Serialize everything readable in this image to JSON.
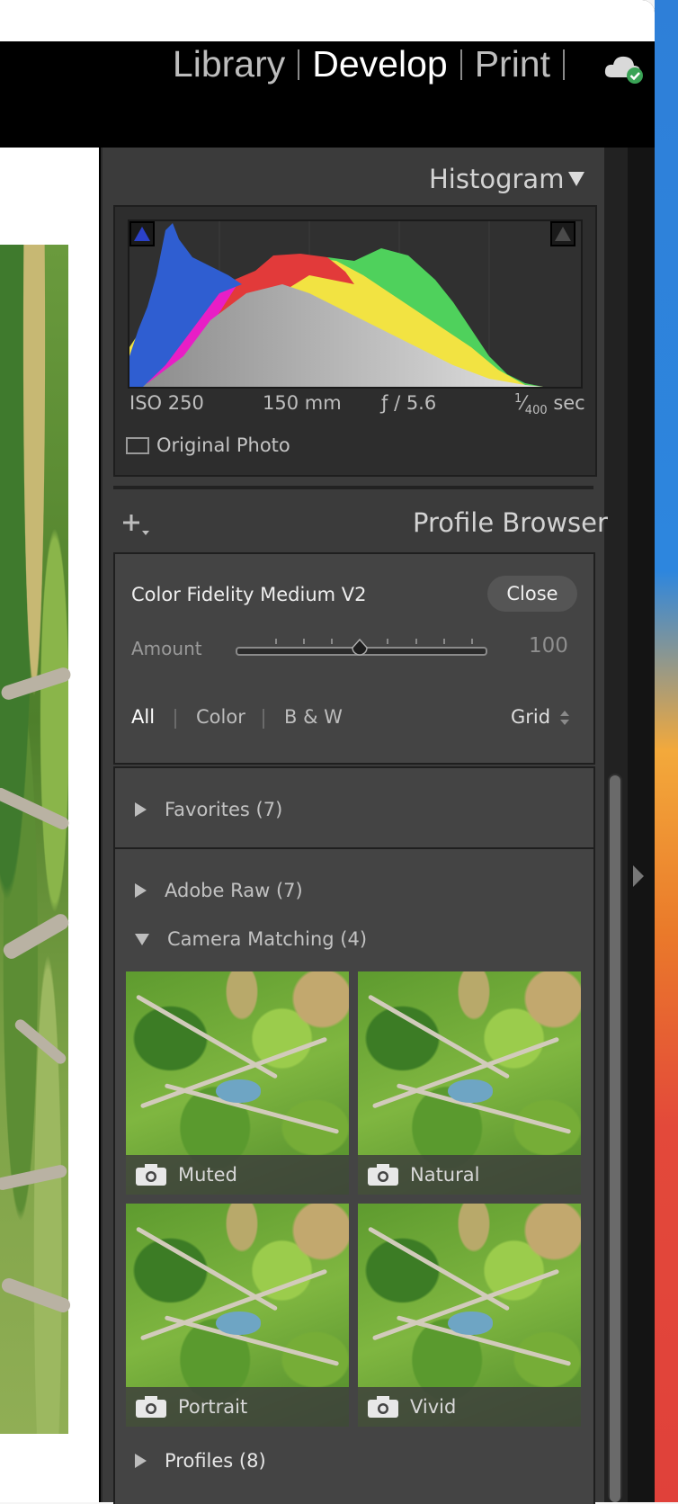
{
  "modules": [
    "Library",
    "Develop",
    "Print"
  ],
  "active_module": "Develop",
  "histogram": {
    "title": "Histogram",
    "iso": "ISO 250",
    "focal": "150 mm",
    "aperture": "ƒ / 5.6",
    "shutter_num": "1",
    "shutter_den": "400",
    "shutter_unit": "sec",
    "original_photo": "Original Photo"
  },
  "profile_browser": {
    "title": "Profile Browser",
    "profile_name": "Color Fidelity Medium V2",
    "close_label": "Close",
    "amount_label": "Amount",
    "amount_value": "100",
    "amount_fraction": 0.5,
    "filters": [
      "All",
      "Color",
      "B & W"
    ],
    "view_mode": "Grid",
    "groups": {
      "favorites": "Favorites (7)",
      "adobe_raw": "Adobe Raw (7)",
      "camera_matching": "Camera Matching (4)",
      "profiles": "Profiles (8)"
    },
    "thumbnails": [
      "Muted",
      "Natural",
      "Portrait",
      "Vivid"
    ]
  },
  "icons": {
    "cloud": "cloud-sync-icon",
    "collapse": "triangle-down-icon",
    "add": "plus-icon",
    "camera": "camera-icon",
    "clipping": "clipping-indicator-icon"
  },
  "colors": {
    "panel_bg": "#3b3b3b",
    "accent_green": "#4caf50",
    "blue_clip": "#2b41c9"
  }
}
